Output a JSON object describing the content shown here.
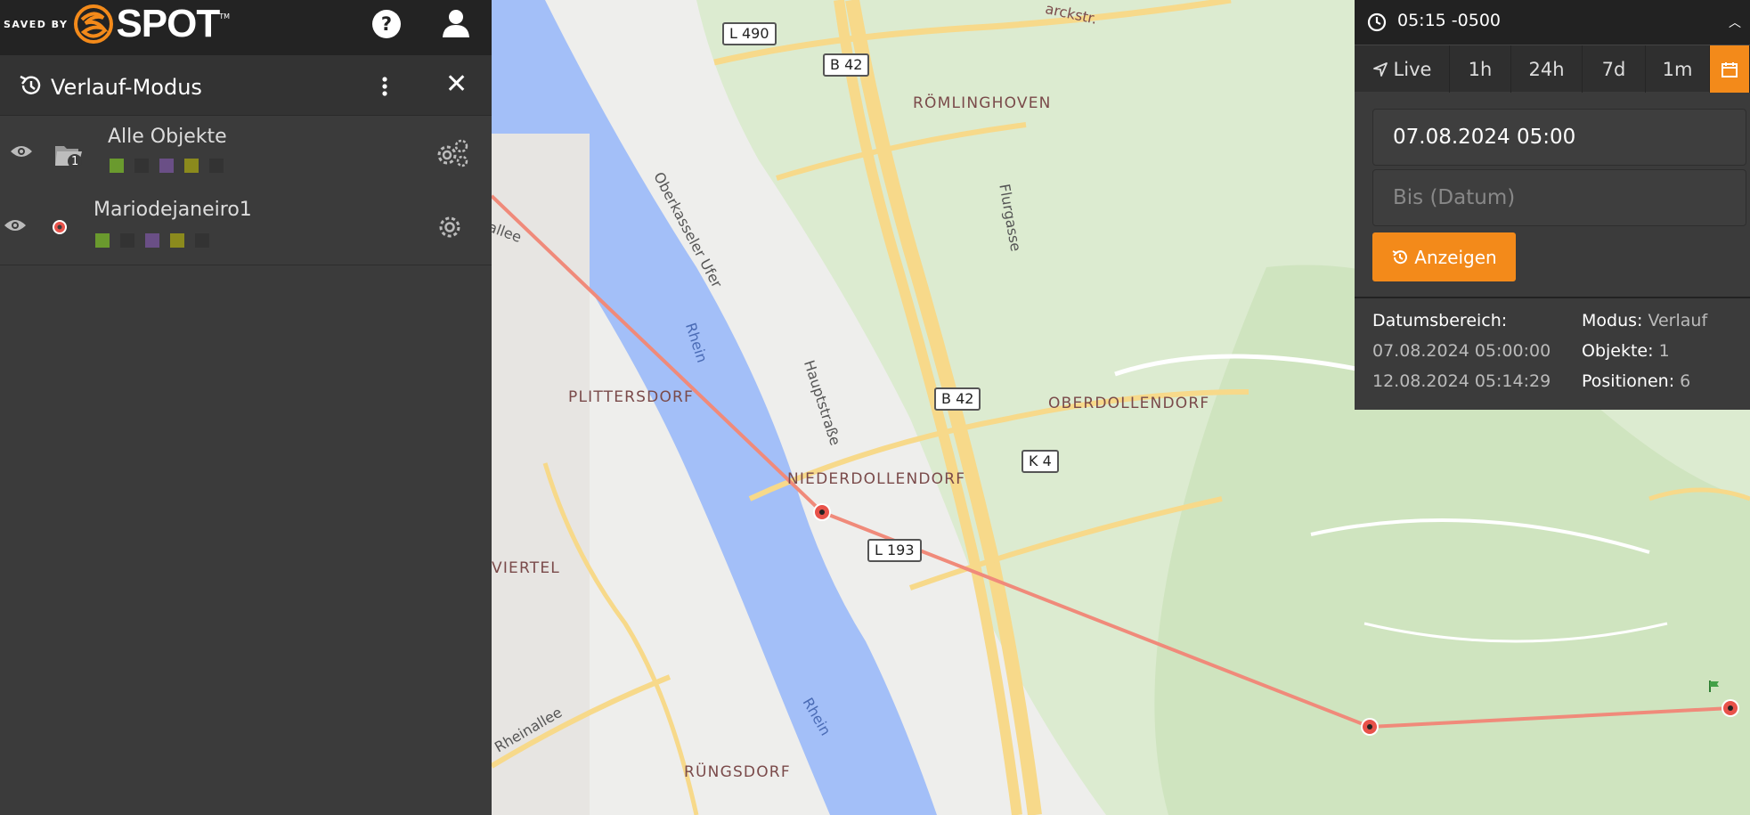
{
  "app": {
    "brand_prefix": "SAVED BY",
    "brand_name": "SPOT",
    "brand_tm": "TM",
    "help_label": "?"
  },
  "sidebar": {
    "title": "Verlauf-Modus",
    "close_label": "✕",
    "rows": [
      {
        "name": "Alle Objekte",
        "badge": "1",
        "swatches": [
          "#6a9a2e",
          "#333333",
          "#6a4f86",
          "#8b8a1d",
          "#333333"
        ]
      },
      {
        "name": "Mariodejaneiro1",
        "swatches": [
          "#6a9a2e",
          "#333333",
          "#6a4f86",
          "#8b8a1d",
          "#333333"
        ]
      }
    ]
  },
  "map": {
    "places": [
      "RÖMLINGHOVEN",
      "PLITTERSDORF",
      "OBERDOLLENDORF",
      "NIEDERDOLLENDORF",
      "VIERTEL",
      "RÜNGSDORF"
    ],
    "roads": [
      "L 490",
      "B 42",
      "B 42",
      "K 4",
      "L 193"
    ],
    "streets": [
      "Oberkasseler Ufer",
      "Flurgasse",
      "Hauptstraße",
      "Rheinallee",
      "allee",
      "Rhein",
      "Rhein",
      "arckstr."
    ],
    "track_color": "#f08a7a"
  },
  "panel": {
    "time": "05:15 -0500",
    "tabs": [
      {
        "label": "Live"
      },
      {
        "label": "1h"
      },
      {
        "label": "24h"
      },
      {
        "label": "7d"
      },
      {
        "label": "1m"
      }
    ],
    "from_value": "07.08.2024 05:00",
    "to_placeholder": "Bis (Datum)",
    "show_label": "Anzeigen",
    "date_range_label": "Datumsbereich:",
    "date_from": "07.08.2024 05:00:00",
    "date_to": "12.08.2024 05:14:29",
    "mode_label": "Modus:",
    "mode_value": "Verlauf",
    "objects_label": "Objekte:",
    "objects_value": "1",
    "positions_label": "Positionen:",
    "positions_value": "6"
  },
  "colors": {
    "accent": "#f38a1a"
  }
}
